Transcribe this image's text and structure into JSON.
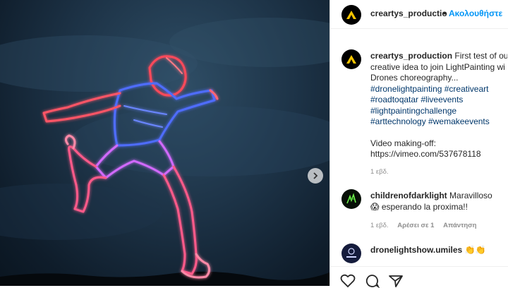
{
  "post": {
    "username": "creartys_production",
    "header_username": "creartys_productio",
    "dot": "•",
    "follow_label": "Ακολουθήστε",
    "caption": {
      "text_lines": [
        "First test of our",
        "creative idea to join LightPainting wi",
        "Drones choreography..."
      ],
      "hashtag_lines": [
        "#dronelightpainting #creativeart",
        "#roadtoqatar #liveevents",
        "#lightpaintingchallenge",
        "#arttechnology #wemakeevents"
      ],
      "video_label": "Video making-off:",
      "video_url": "https://vimeo.com/537678118",
      "time": "1 εβδ."
    }
  },
  "comments": [
    {
      "username": "childrenofdarklight",
      "text": "Maravilloso",
      "text2": "😱 esperando la proxima!!",
      "time": "1 εβδ.",
      "likes": "Αρέσει σε 1",
      "reply": "Απάντηση"
    },
    {
      "username": "dronelightshow.umiles",
      "text": "👏👏"
    }
  ],
  "icons": {
    "next": "chevron-right-icon",
    "like": "heart-icon",
    "comment": "comment-icon",
    "share": "share-icon"
  },
  "colors": {
    "link": "#0095f6",
    "hashtag": "#00376b",
    "muted": "#8e8e8e",
    "brand_yellow": "#f5c400"
  }
}
